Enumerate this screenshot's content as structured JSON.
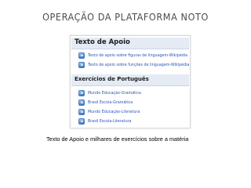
{
  "slide": {
    "title": "OPERAÇÃO DA PLATAFORMA NOTO",
    "caption": "Texto de Apoio e milhares de exercícios sobre a matéria"
  },
  "panel": {
    "sections": [
      {
        "heading": "Texto de Apoio",
        "links": [
          "Texto de apoio sobre figuras de linguagem-Wikipédia",
          "Texto de apoio sobre funções de linguagem-Wikipédia"
        ]
      },
      {
        "heading": "Exercícios de Português",
        "links": [
          "Mundo Educação-Gramática",
          "Brasil Escola-Gramática",
          "Mundo Educação-Literatura",
          "Brasil Escola-Literatura"
        ]
      }
    ]
  },
  "colors": {
    "link": "#2a55b8",
    "header_bg": "#e4ebf5",
    "icon": "#5b8fcf"
  },
  "icons": {
    "resource": "document-icon"
  }
}
